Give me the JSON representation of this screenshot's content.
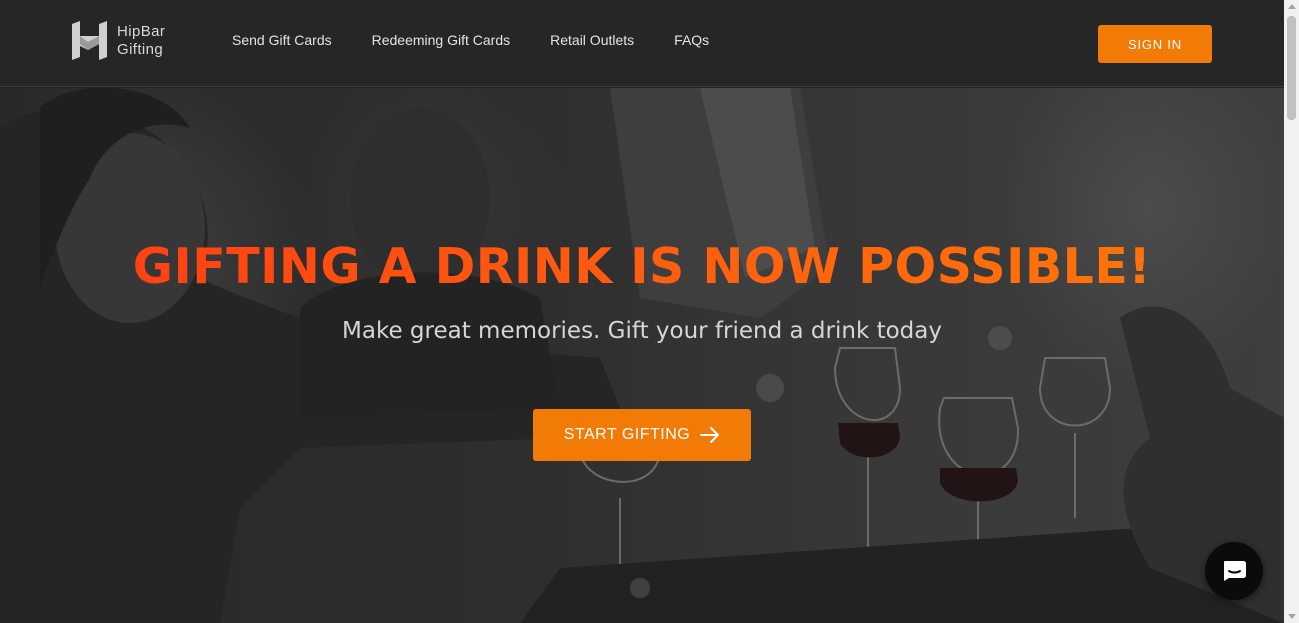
{
  "header": {
    "brand_line1": "HipBar",
    "brand_line2": "Gifting",
    "nav": [
      {
        "label": "Send Gift Cards"
      },
      {
        "label": "Redeeming Gift Cards"
      },
      {
        "label": "Retail Outlets"
      },
      {
        "label": "FAQs"
      }
    ],
    "signin_label": "SIGN IN"
  },
  "hero": {
    "headline": "GIFTING A DRINK IS NOW POSSIBLE!",
    "subline": "Make great memories. Gift your friend a drink today",
    "cta_label": "START GIFTING",
    "cta_icon": "arrow-right-icon"
  },
  "chat": {
    "icon": "chat-bubble-icon"
  },
  "colors": {
    "accent": "#f27b08",
    "headline_start": "#ff3a12",
    "headline_end": "#ff7a08",
    "header_bg": "#262626"
  }
}
